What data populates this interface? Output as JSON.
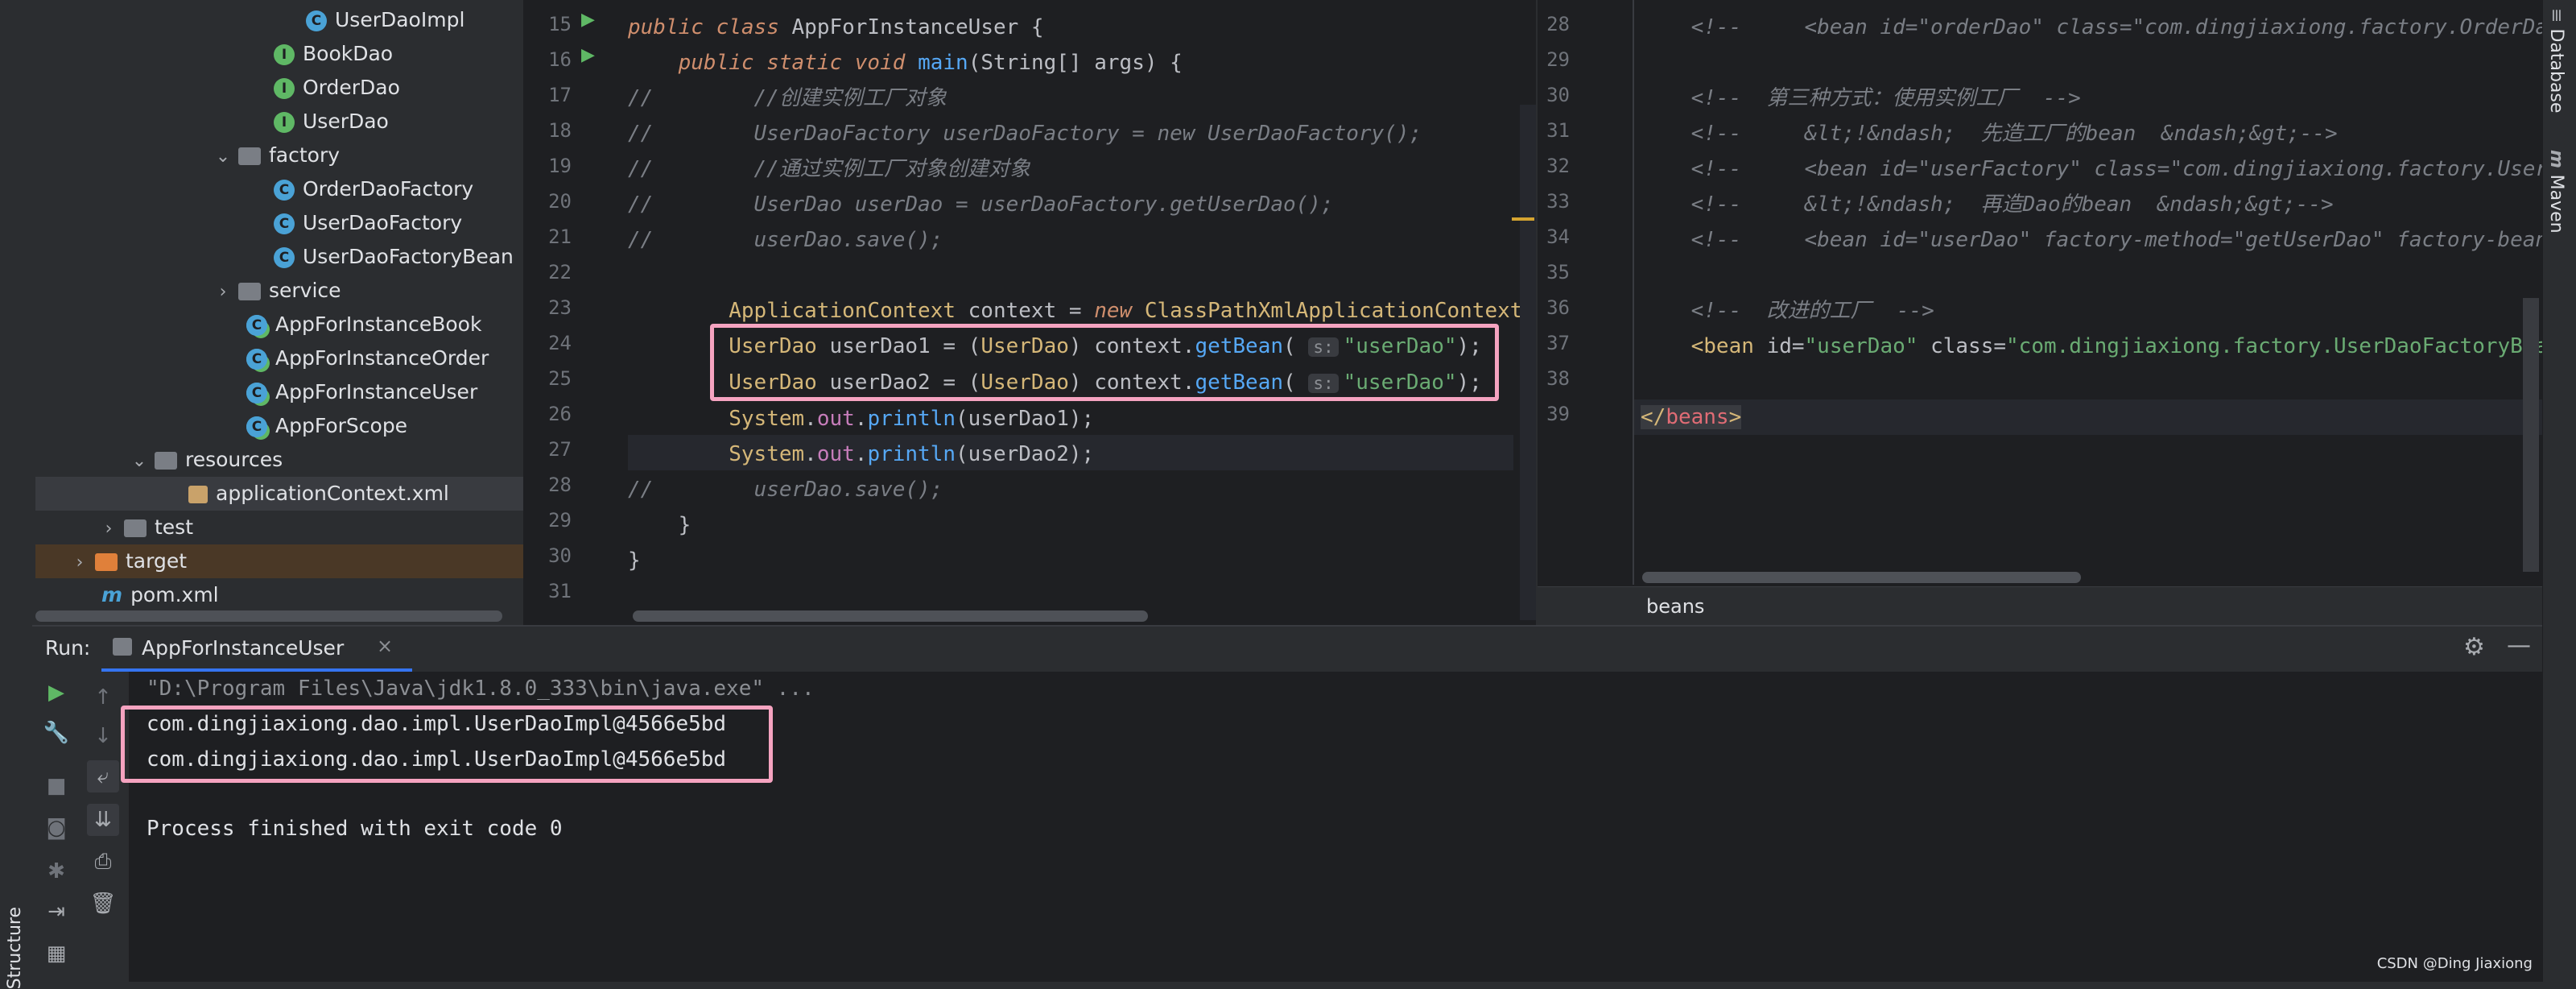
{
  "project_tree": [
    {
      "label": "UserDaoImpl",
      "icon": "class-icon"
    },
    {
      "label": "BookDao",
      "icon": "interface-icon"
    },
    {
      "label": "OrderDao",
      "icon": "interface-icon"
    },
    {
      "label": "UserDao",
      "icon": "interface-icon"
    },
    {
      "label": "factory",
      "icon": "folder-icon"
    },
    {
      "label": "OrderDaoFactory",
      "icon": "class-icon"
    },
    {
      "label": "UserDaoFactory",
      "icon": "class-icon"
    },
    {
      "label": "UserDaoFactoryBean",
      "icon": "class-icon"
    },
    {
      "label": "service",
      "icon": "folder-icon"
    },
    {
      "label": "AppForInstanceBook",
      "icon": "app-icon"
    },
    {
      "label": "AppForInstanceOrder",
      "icon": "app-icon"
    },
    {
      "label": "AppForInstanceUser",
      "icon": "app-icon"
    },
    {
      "label": "AppForScope",
      "icon": "app-icon"
    },
    {
      "label": "resources",
      "icon": "folder-icon"
    },
    {
      "label": "applicationContext.xml",
      "icon": "xml-icon"
    },
    {
      "label": "test",
      "icon": "folder-icon"
    },
    {
      "label": "target",
      "icon": "folder-icon"
    },
    {
      "label": "pom.xml",
      "icon": "maven-icon"
    }
  ],
  "left_editor": {
    "line_numbers": [
      "15",
      "16",
      "17",
      "18",
      "19",
      "20",
      "21",
      "22",
      "23",
      "24",
      "25",
      "26",
      "27",
      "28",
      "29",
      "30",
      "31"
    ],
    "hint_label": "s:"
  },
  "right_editor": {
    "line_numbers": [
      "28",
      "29",
      "30",
      "31",
      "32",
      "33",
      "34",
      "35",
      "36",
      "37",
      "38",
      "39"
    ],
    "breadcrumb": "beans"
  },
  "right_tool_tabs": [
    "Database",
    "Maven"
  ],
  "left_tool_tabs": [
    "Structure"
  ],
  "run_panel": {
    "label": "Run:",
    "tab_name": "AppForInstanceUser",
    "output": [
      "\"D:\\Program Files\\Java\\jdk1.8.0_333\\bin\\java.exe\" ...",
      "com.dingjiaxiong.dao.impl.UserDaoImpl@4566e5bd",
      "com.dingjiaxiong.dao.impl.UserDaoImpl@4566e5bd",
      "",
      "Process finished with exit code 0"
    ]
  },
  "watermark": "CSDN @Ding Jiaxiong",
  "colors": {
    "highlight_box": "#f5a3c0",
    "background": "#1e1f22",
    "panel": "#2b2d30"
  }
}
